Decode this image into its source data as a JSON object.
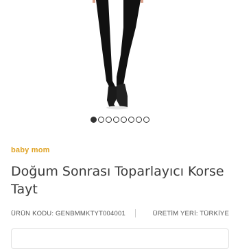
{
  "product": {
    "image_alt": "Siyah tayt giymiş model, siyah spor ayakkabı",
    "carousel": {
      "total": 8,
      "active_index": 0
    },
    "brand": "baby mom",
    "title": "Doğum Sonrası Toparlayıcı Korse Tayt",
    "code_label": "ÜRÜN KODU:",
    "code_value": "GENBMMKTYT004001",
    "origin_label": "ÜRETİM YERİ:",
    "origin_value": "TÜRKİYE"
  },
  "colors": {
    "brand": "#e0a325",
    "text": "#3a3a3a"
  }
}
